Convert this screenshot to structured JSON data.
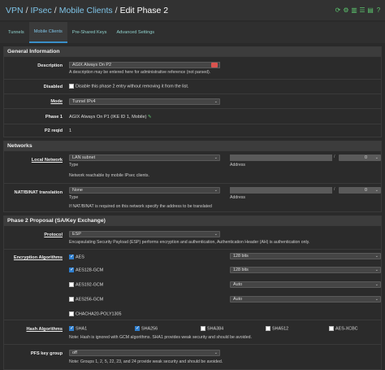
{
  "breadcrumb": {
    "vpn": "VPN",
    "ipsec": "IPsec",
    "mobile": "Mobile Clients",
    "current": "Edit Phase 2",
    "sep": "/"
  },
  "tabs": [
    {
      "label": "Tunnels"
    },
    {
      "label": "Mobile Clients"
    },
    {
      "label": "Pre-Shared Keys"
    },
    {
      "label": "Advanced Settings"
    }
  ],
  "general": {
    "title": "General Information",
    "description_label": "Description",
    "description_value": "AGIX Always On P2",
    "description_help": "A description may be entered here for administrative reference (not parsed).",
    "disabled_label": "Disabled",
    "disabled_text": "Disable this phase 2 entry without removing it from the list.",
    "mode_label": "Mode",
    "mode_value": "Tunnel IPv4",
    "phase1_label": "Phase 1",
    "phase1_value": "AGIX Always On P1 (IKE ID 1, Mobile)",
    "p2reqid_label": "P2 reqid",
    "p2reqid_value": "1"
  },
  "networks": {
    "title": "Networks",
    "local_label": "Local Network",
    "local_value": "LAN subnet",
    "type_label": "Type",
    "address_label": "Address",
    "local_help": "Network reachable by mobile IPsec clients.",
    "nat_label": "NAT/BINAT translation",
    "nat_value": "None",
    "nat_help": "If NAT/BINAT is required on this network specify the address to be translated",
    "mask": "0",
    "slash": "/"
  },
  "p2": {
    "title": "Phase 2 Proposal (SA/Key Exchange)",
    "protocol_label": "Protocol",
    "protocol_value": "ESP",
    "protocol_help": "Encapsulating Security Payload (ESP) performs encryption and authentication, Authentication Header (AH) is authentication only.",
    "enc_label": "Encryption Algorithms",
    "enc": [
      {
        "name": "AES",
        "bits": "128 bits"
      },
      {
        "name": "AES128-GCM",
        "bits": "128 bits"
      },
      {
        "name": "AES192-GCM",
        "bits": "Auto"
      },
      {
        "name": "AES256-GCM",
        "bits": "Auto"
      },
      {
        "name": "CHACHA20-POLY1305",
        "bits": ""
      }
    ],
    "hash_label": "Hash Algorithms",
    "hash": [
      {
        "name": "SHA1"
      },
      {
        "name": "SHA256"
      },
      {
        "name": "SHA384"
      },
      {
        "name": "SHA512"
      },
      {
        "name": "AES-XCBC"
      }
    ],
    "hash_help": "Note: Hash is ignored with GCM algorithms. SHA1 provides weak security and should be avoided.",
    "pfs_label": "PFS key group",
    "pfs_value": "off",
    "pfs_help": "Note: Groups 1, 2, 5, 22, 23, and 24 provide weak security and should be avoided."
  },
  "colors": {
    "accent": "#7ec3e6",
    "checkbox": "#2f7fcf",
    "icons": "#5cc56e"
  }
}
